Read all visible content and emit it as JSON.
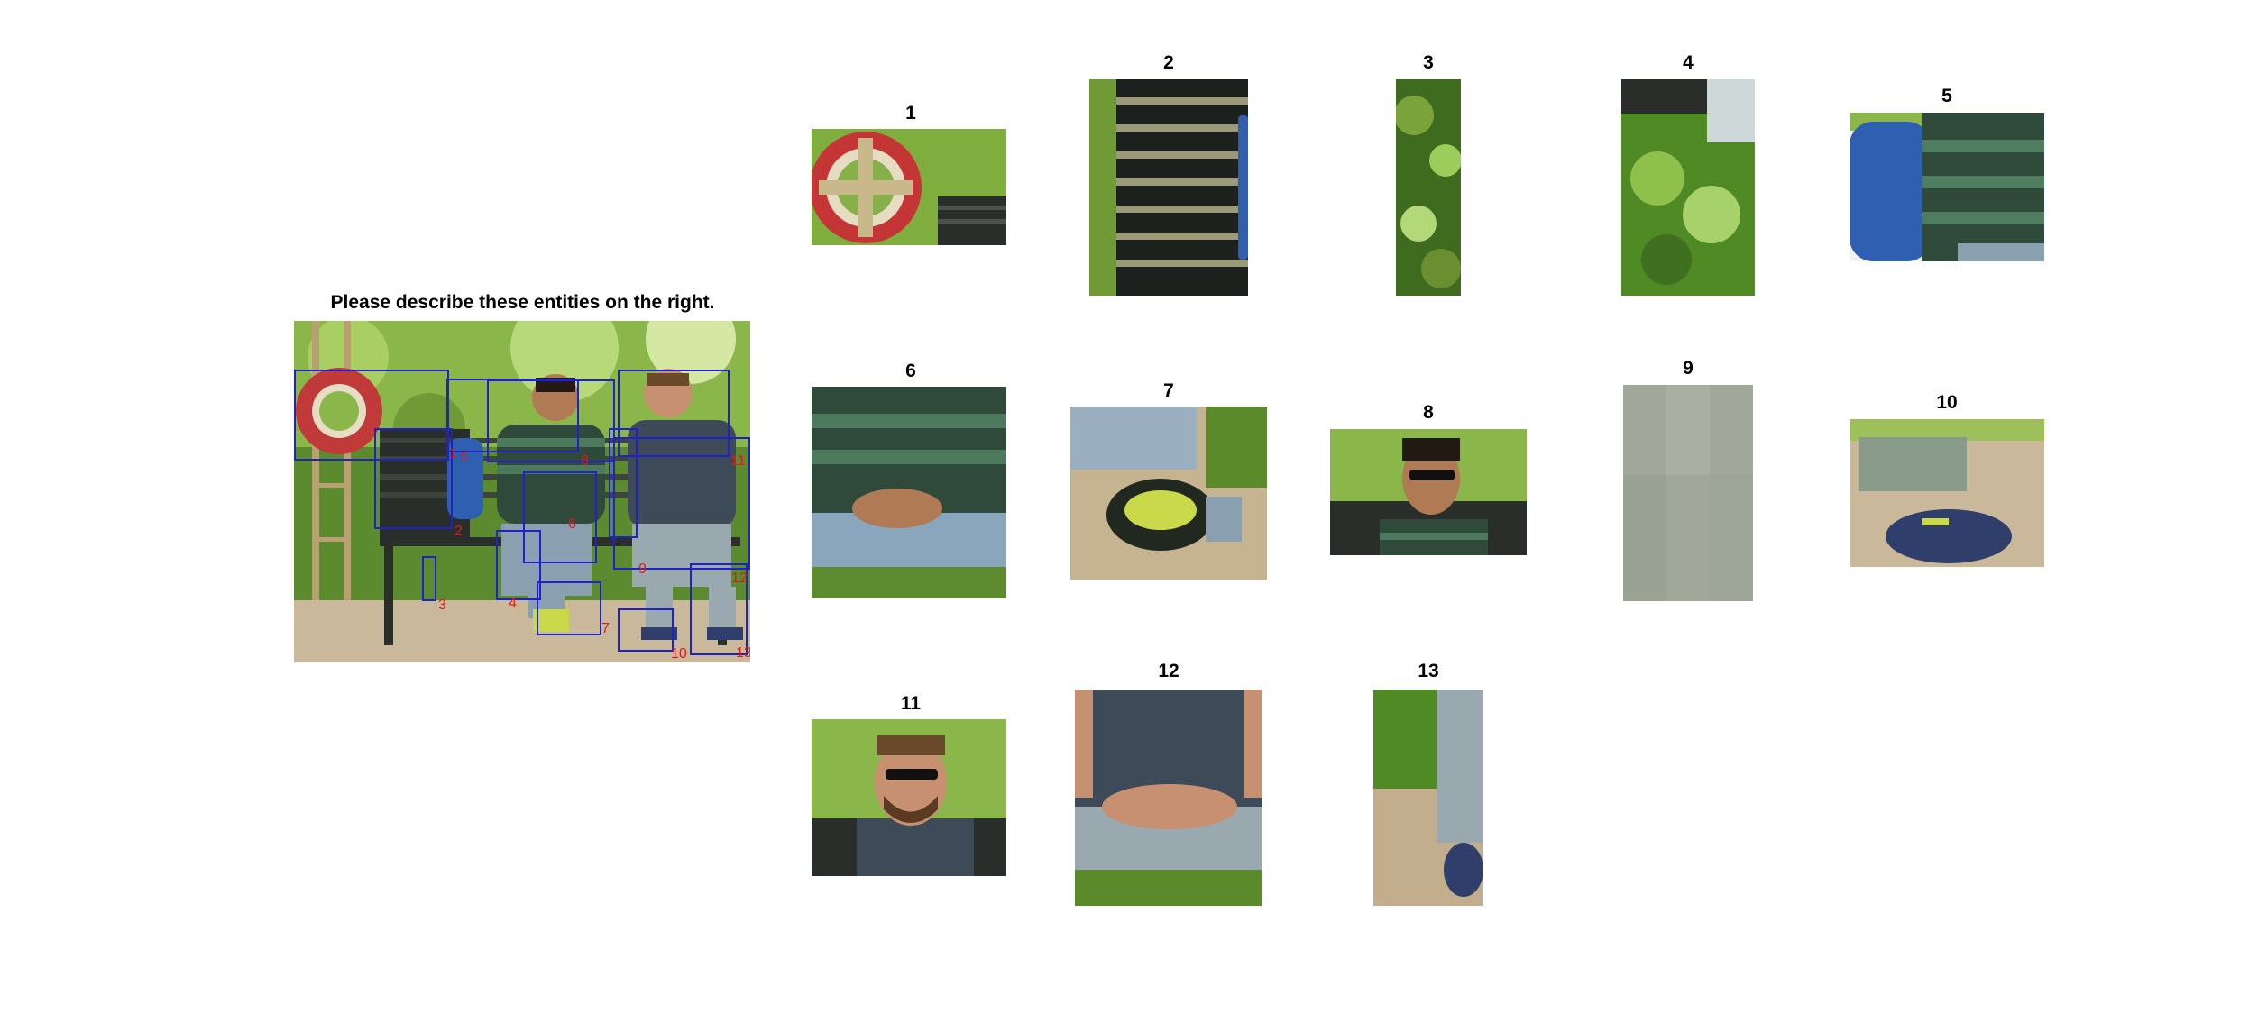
{
  "title": "Please describe these entities on the right.",
  "box_color": "#1f22c8",
  "label_color": "#e01a1a",
  "main_image": {
    "description_icon": "photo-two-men-on-bench",
    "box_labels": [
      "1",
      "2",
      "3",
      "4",
      "5",
      "6",
      "7",
      "8",
      "9",
      "10",
      "11",
      "12",
      "13"
    ]
  },
  "crops": [
    {
      "label": "1",
      "icon": "lifebuoy-ring"
    },
    {
      "label": "2",
      "icon": "bench-slats"
    },
    {
      "label": "3",
      "icon": "foliage"
    },
    {
      "label": "4",
      "icon": "foliage-with-post"
    },
    {
      "label": "5",
      "icon": "backpack-and-shirt"
    },
    {
      "label": "6",
      "icon": "torso-hands"
    },
    {
      "label": "7",
      "icon": "sneakers"
    },
    {
      "label": "8",
      "icon": "man-with-sunglasses"
    },
    {
      "label": "9",
      "icon": "gray-patch"
    },
    {
      "label": "10",
      "icon": "shoe"
    },
    {
      "label": "11",
      "icon": "bearded-man-sunglasses"
    },
    {
      "label": "12",
      "icon": "torso-crossed-hands"
    },
    {
      "label": "13",
      "icon": "leg-and-shoe"
    }
  ]
}
